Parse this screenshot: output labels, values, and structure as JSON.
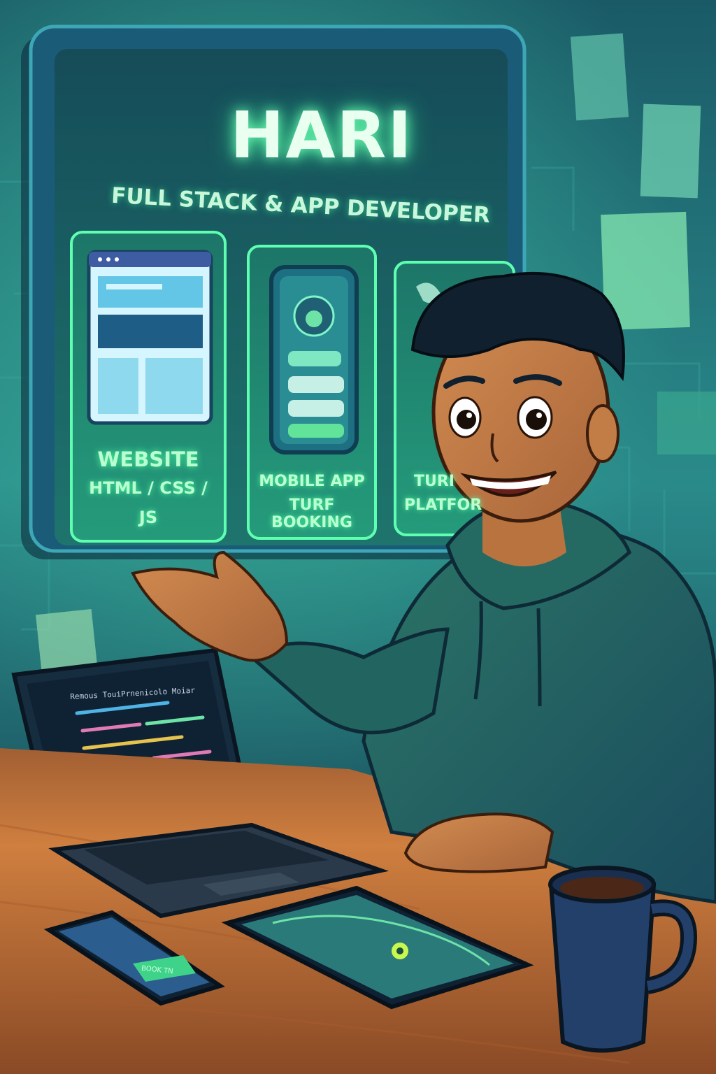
{
  "hero": {
    "name": "HARI",
    "tagline": "FULL STACK & APP DEVELOPER"
  },
  "cards": [
    {
      "title": "WEBSITE",
      "line2": "HTML / CSS /",
      "line3": "JS"
    },
    {
      "title": "MOBILE APP",
      "line2": "TURF BOOKING"
    },
    {
      "title": "TURI",
      "line2": "PLATFOR"
    }
  ],
  "laptop": {
    "editor_header": "Remous TouiPrnenicolo Moiar"
  },
  "phone": {
    "button_label": "BOOK TN"
  },
  "colors": {
    "glow": "#5dffae",
    "panel": "#123c57",
    "hoodie": "#1f5a68",
    "desk": "#c8773c",
    "mug": "#22406a"
  }
}
